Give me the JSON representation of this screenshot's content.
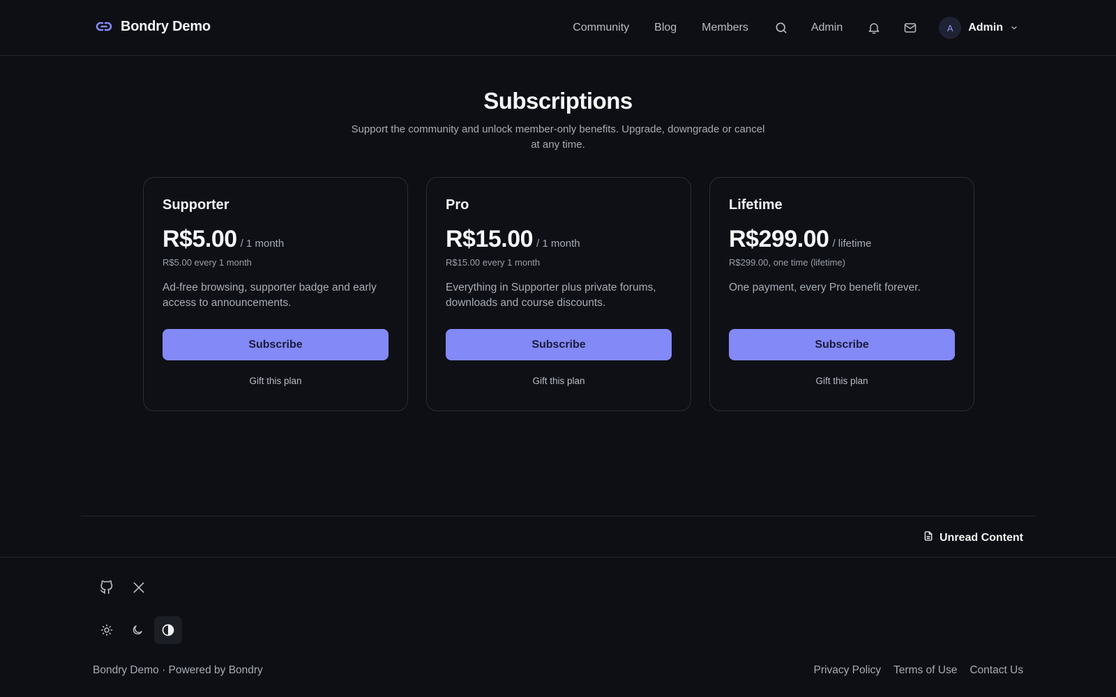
{
  "header": {
    "brand": "Bondry Demo",
    "nav": [
      "Community",
      "Blog",
      "Members"
    ],
    "admin_link": "Admin",
    "user": {
      "initial": "A",
      "name": "Admin"
    }
  },
  "hero": {
    "title": "Subscriptions",
    "subtitle": "Support the community and unlock member-only benefits. Upgrade, downgrade or cancel at any time."
  },
  "plans": [
    {
      "name": "Supporter",
      "price": "R$5.00",
      "period": "/ 1 month",
      "billing": "R$5.00 every 1 month",
      "description": "Ad-free browsing, supporter badge and early access to announcements.",
      "cta": "Subscribe",
      "gift": "Gift this plan"
    },
    {
      "name": "Pro",
      "price": "R$15.00",
      "period": "/ 1 month",
      "billing": "R$15.00 every 1 month",
      "description": "Everything in Supporter plus private forums, downloads and course discounts.",
      "cta": "Subscribe",
      "gift": "Gift this plan"
    },
    {
      "name": "Lifetime",
      "price": "R$299.00",
      "period": "/ lifetime",
      "billing": "R$299.00, one time (lifetime)",
      "description": "One payment, every Pro benefit forever.",
      "cta": "Subscribe",
      "gift": "Gift this plan"
    }
  ],
  "unread": {
    "label": "Unread Content"
  },
  "footer": {
    "copyright": "Bondry Demo · Powered by Bondry",
    "links": [
      "Privacy Policy",
      "Terms of Use",
      "Contact Us"
    ],
    "theme_active": "high-contrast"
  },
  "colors": {
    "background": "#0d0f14",
    "accent": "#8389f6",
    "border": "#2a2d35"
  },
  "icons": [
    "chain-link-logo-icon",
    "search-icon",
    "bell-icon",
    "mail-icon",
    "chevron-down-icon",
    "document-icon",
    "github-icon",
    "x-icon",
    "sun-icon",
    "moon-icon",
    "contrast-icon"
  ]
}
